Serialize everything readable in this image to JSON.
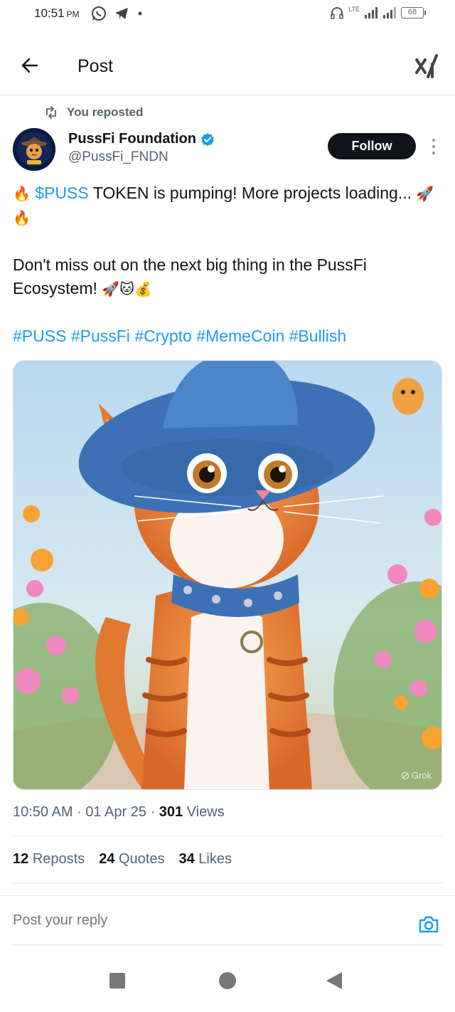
{
  "status_bar": {
    "time": "10:51",
    "ampm": "PM",
    "network": "LTE",
    "battery": "68",
    "icons": [
      "whatsapp-icon",
      "telegram-icon",
      "dot-icon",
      "headset-icon",
      "signal-icon",
      "signal-icon",
      "battery-icon"
    ]
  },
  "header": {
    "title": "Post",
    "back_icon": "back-arrow-icon",
    "logo_icon": "x-logo-icon"
  },
  "repost": {
    "text": "You reposted",
    "icon": "repost-icon"
  },
  "author": {
    "name": "PussFi Foundation",
    "handle": "@PussFi_FNDN",
    "verified": true,
    "verified_color": "#1d9bf0",
    "follow_label": "Follow"
  },
  "post": {
    "p1_emoji_start": "🔥",
    "cashtag": "$PUSS",
    "p1_text": " TOKEN is pumping! More projects loading...",
    "p1_emoji_end": "🚀🔥",
    "p2_text": "Don't miss out on the next big thing in the PussFi Ecosystem!",
    "p2_emoji": "🚀🐱💰",
    "hashtags": [
      "#PUSS",
      "#PussFi",
      "#Crypto",
      "#MemeCoin",
      "#Bullish"
    ],
    "image_watermark": "Grok"
  },
  "meta": {
    "time": "10:50 AM",
    "date": "01 Apr 25",
    "views_count": "301",
    "views_label": "Views"
  },
  "stats": {
    "reposts_count": "12",
    "reposts_label": "Reposts",
    "quotes_count": "24",
    "quotes_label": "Quotes",
    "likes_count": "34",
    "likes_label": "Likes"
  },
  "reply": {
    "placeholder": "Post your reply",
    "camera_icon": "camera-icon"
  },
  "colors": {
    "link": "#1d9bf0",
    "text": "#0f1419",
    "secondary": "#536471",
    "follow_bg": "#0f1419"
  }
}
